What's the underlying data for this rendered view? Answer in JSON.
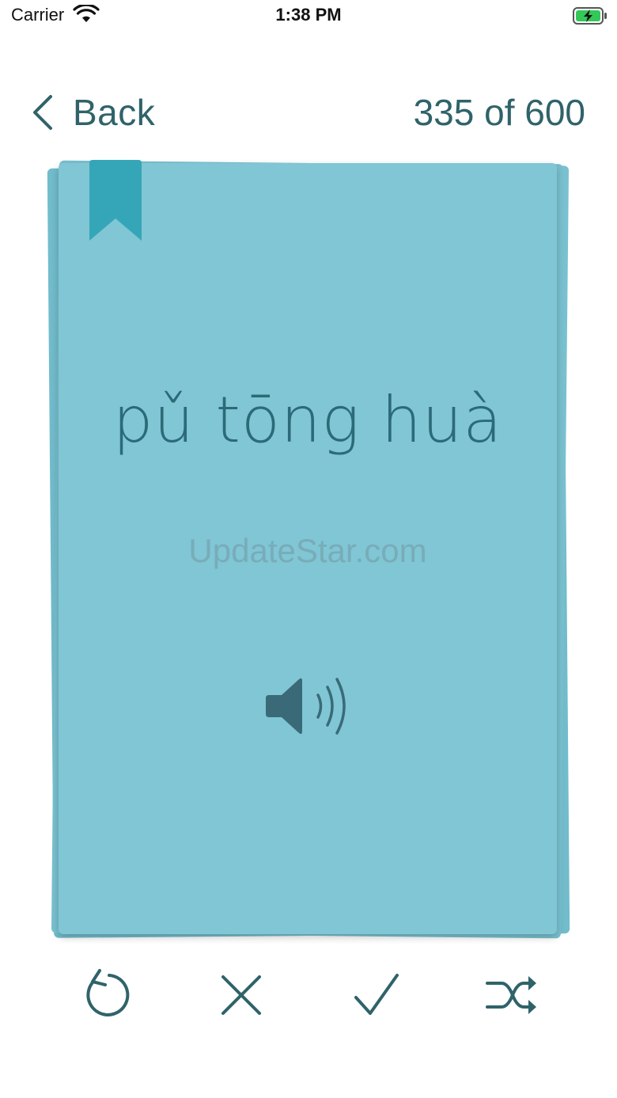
{
  "status_bar": {
    "carrier": "Carrier",
    "time": "1:38 PM",
    "wifi_icon": "wifi-icon",
    "battery_icon": "battery-charging-icon"
  },
  "nav": {
    "back_label": "Back",
    "back_icon": "chevron-left-icon",
    "counter": "335 of 600"
  },
  "card": {
    "word": "pǔ tōng huà",
    "watermark": "UpdateStar.com",
    "bookmark_icon": "bookmark-icon",
    "audio_icon": "speaker-icon"
  },
  "toolbar": {
    "icons": [
      "undo-icon",
      "close-icon",
      "check-icon",
      "shuffle-icon"
    ]
  },
  "colors": {
    "card": "#80c6d4",
    "bookmark": "#35a6b8",
    "accent": "#2f6369"
  }
}
